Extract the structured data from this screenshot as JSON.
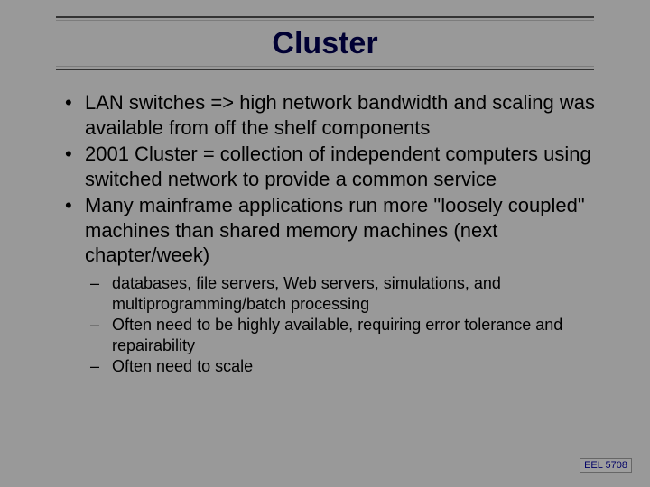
{
  "title": "Cluster",
  "bullets": [
    "LAN switches => high network bandwidth and scaling was available from off the shelf components",
    "2001 Cluster = collection of independent computers using switched network to provide a common service",
    "Many mainframe applications run more \"loosely coupled\" machines than shared memory machines (next chapter/week)"
  ],
  "subBullets": [
    " databases, file servers, Web servers, simulations, and multiprogramming/batch processing",
    "Often need to be highly available, requiring error tolerance and repairability",
    "Often need to scale"
  ],
  "footer": "EEL 5708"
}
